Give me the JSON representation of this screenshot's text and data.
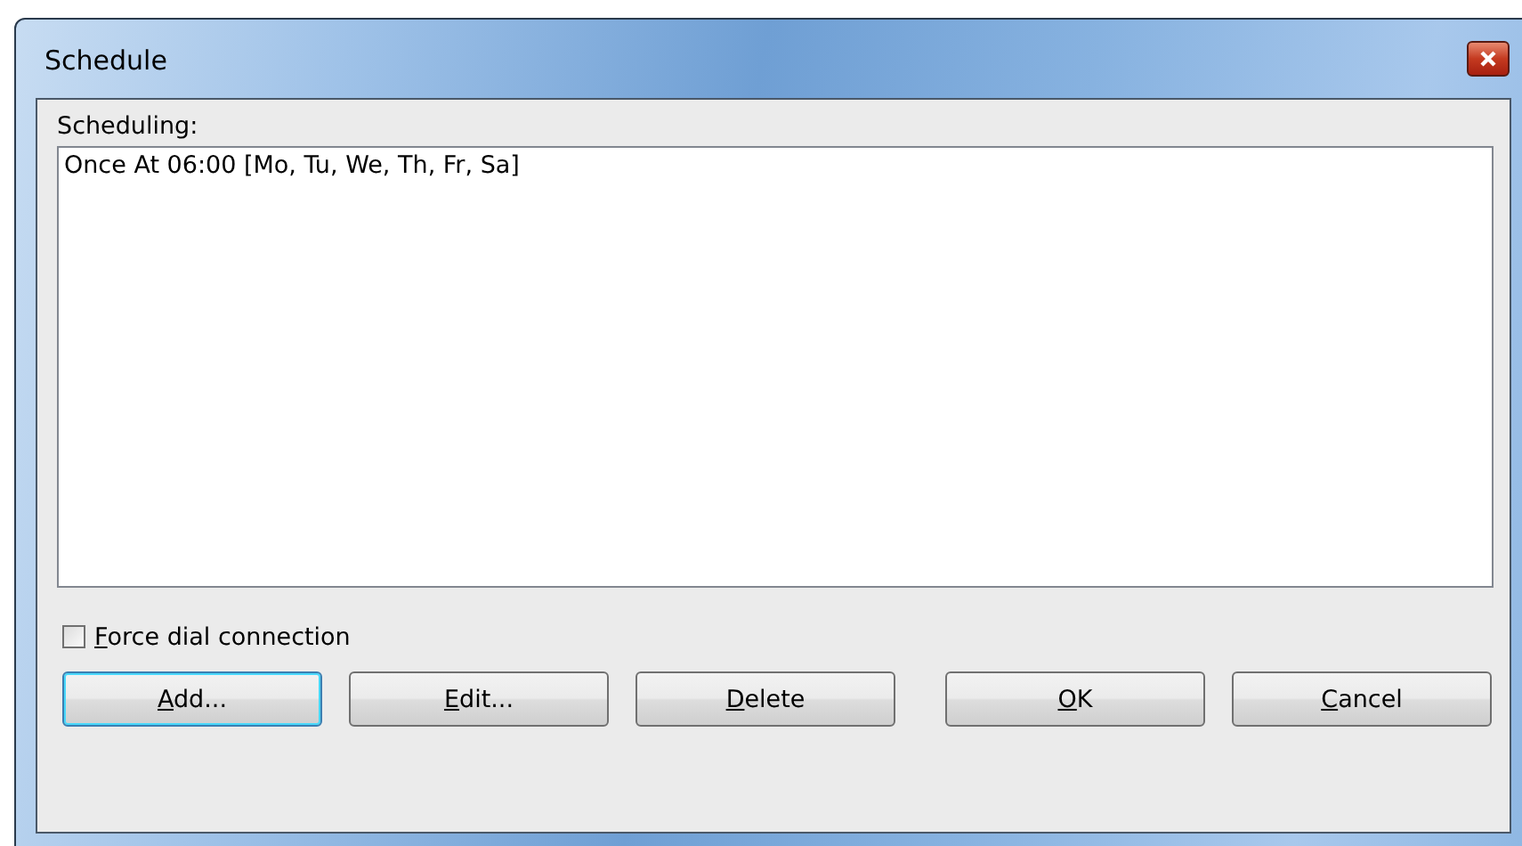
{
  "window": {
    "title": "Schedule"
  },
  "list_label": "Scheduling:",
  "list_items": [
    {
      "text": "Once At 06:00 [Mo, Tu, We, Th, Fr, Sa]",
      "selected": false
    }
  ],
  "force_dial": {
    "underlined": "F",
    "rest": "orce dial connection",
    "checked": false
  },
  "buttons": [
    {
      "underlined": "A",
      "rest": "dd...",
      "default": true
    },
    {
      "underlined": "E",
      "rest": "dit...",
      "default": false
    },
    {
      "underlined": "D",
      "rest": "elete",
      "default": false
    },
    {
      "underlined": "O",
      "rest": "K",
      "default": false
    },
    {
      "underlined": "C",
      "rest": "ancel",
      "default": false
    }
  ]
}
